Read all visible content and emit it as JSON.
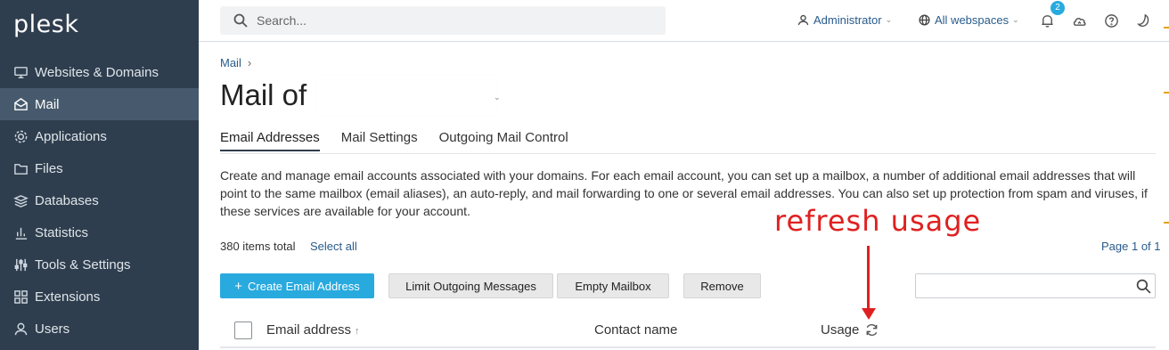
{
  "app": {
    "logo": "plesk"
  },
  "sidebar": {
    "items": [
      {
        "label": "Websites & Domains",
        "icon": "monitor-icon"
      },
      {
        "label": "Mail",
        "icon": "mail-icon",
        "active": true
      },
      {
        "label": "Applications",
        "icon": "gear-icon"
      },
      {
        "label": "Files",
        "icon": "folder-icon"
      },
      {
        "label": "Databases",
        "icon": "database-icon"
      },
      {
        "label": "Statistics",
        "icon": "bar-chart-icon"
      },
      {
        "label": "Tools & Settings",
        "icon": "sliders-icon"
      },
      {
        "label": "Extensions",
        "icon": "grid-icon"
      },
      {
        "label": "Users",
        "icon": "user-icon"
      }
    ]
  },
  "topbar": {
    "search_placeholder": "Search...",
    "user_label": "Administrator",
    "webspaces_label": "All webspaces",
    "notification_count": "2"
  },
  "breadcrumb": {
    "item": "Mail",
    "separator": "›"
  },
  "page": {
    "title": "Mail of",
    "tabs": [
      "Email Addresses",
      "Mail Settings",
      "Outgoing Mail Control"
    ],
    "description": "Create and manage email accounts associated with your domains. For each email account, you can set up a mailbox, a number of additional email addresses that will point to the same mailbox (email aliases), an auto-reply, and mail forwarding to one or several email addresses. You can also set up protection from spam and viruses, if these services are available for your account."
  },
  "list": {
    "count_text": "380 items total",
    "select_all": "Select all",
    "page_info": "Page 1 of 1"
  },
  "toolbar": {
    "create_label": "Create Email Address",
    "create_prefix": "+",
    "limit_label": "Limit Outgoing Messages",
    "empty_label": "Empty Mailbox",
    "remove_label": "Remove"
  },
  "table": {
    "columns": [
      "Email address",
      "Contact name",
      "Usage"
    ],
    "sort_indicator": "↑"
  },
  "annotation": {
    "text": "refresh usage",
    "color": "#e02020"
  },
  "colors": {
    "sidebar_bg": "#2f3e4e",
    "accent": "#28aade",
    "link": "#285b8c"
  }
}
